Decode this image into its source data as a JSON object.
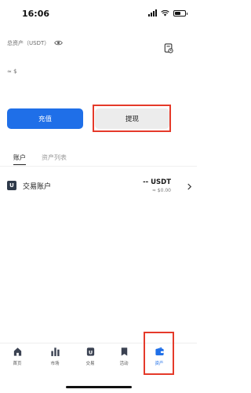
{
  "status_bar": {
    "time": "16:06"
  },
  "asset_summary": {
    "label": "总资产（USDT）",
    "approx_value": "≈ $"
  },
  "actions": {
    "deposit_label": "充值",
    "withdraw_label": "提现"
  },
  "tabs": [
    {
      "label": "账户",
      "active": true
    },
    {
      "label": "资产列表",
      "active": false
    }
  ],
  "accounts": [
    {
      "icon": "U",
      "name": "交易账户",
      "amount": "-- USDT",
      "sub_value": "≈ $0.00"
    }
  ],
  "bottom_nav": [
    {
      "label": "首页",
      "icon": "home-icon"
    },
    {
      "label": "市场",
      "icon": "bar-chart-icon"
    },
    {
      "label": "交易",
      "icon": "trade-icon"
    },
    {
      "label": "活动",
      "icon": "bookmark-icon"
    },
    {
      "label": "资产",
      "icon": "wallet-icon",
      "active": true
    }
  ],
  "colors": {
    "primary": "#1f6fe8",
    "highlight": "#e53a2a"
  }
}
